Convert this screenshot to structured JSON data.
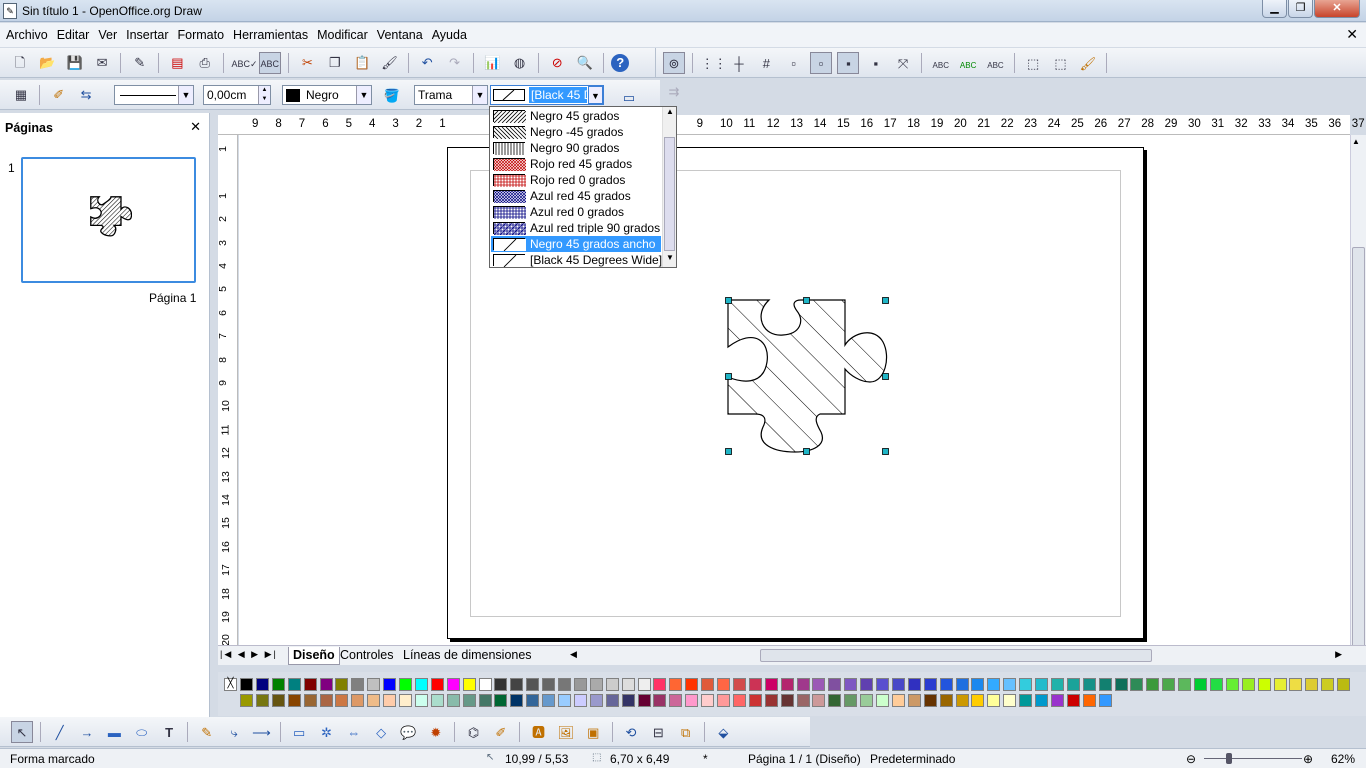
{
  "window": {
    "title": "Sin título 1 - OpenOffice.org Draw",
    "min_label": "▁",
    "max_label": "❐",
    "close_label": "✕"
  },
  "menu": [
    "Archivo",
    "Editar",
    "Ver",
    "Insertar",
    "Formato",
    "Herramientas",
    "Modificar",
    "Ventana",
    "Ayuda"
  ],
  "doc_close": "✕",
  "line_toolbar": {
    "line_width": "0,00cm",
    "line_color": "Negro",
    "area_style": "Trama",
    "pattern": "[Black 45 D"
  },
  "pages_panel": {
    "title": "Páginas",
    "close": "✕",
    "number": "1",
    "label": "Página 1"
  },
  "ruler": {
    "h_labels": [
      "9",
      "8",
      "7",
      "6",
      "5",
      "4",
      "3",
      "2",
      "1",
      "",
      "",
      "",
      "",
      "",
      "",
      "",
      "",
      "",
      "",
      "9",
      "10",
      "11",
      "12",
      "13",
      "14",
      "15",
      "16",
      "17",
      "18",
      "19",
      "20",
      "21",
      "22",
      "23",
      "24",
      "25",
      "26",
      "27",
      "28",
      "29",
      "30",
      "31",
      "32",
      "33",
      "34",
      "35",
      "36",
      "37"
    ],
    "v_labels": [
      "1",
      "",
      "1",
      "2",
      "3",
      "4",
      "5",
      "6",
      "7",
      "8",
      "9",
      "10",
      "11",
      "12",
      "13",
      "14",
      "15",
      "16",
      "17",
      "18",
      "19",
      "20"
    ]
  },
  "dropdown_items": [
    {
      "label": "Negro 45 grados",
      "pattern": "hatch45",
      "color": "#000000"
    },
    {
      "label": "Negro -45 grados",
      "pattern": "hatch-45",
      "color": "#000000"
    },
    {
      "label": "Negro 90 grados",
      "pattern": "hatch90",
      "color": "#000000"
    },
    {
      "label": "Rojo red 45 grados",
      "pattern": "cross45",
      "color": "#c00000"
    },
    {
      "label": "Rojo red 0 grados",
      "pattern": "cross0",
      "color": "#c00000"
    },
    {
      "label": "Azul red 45 grados",
      "pattern": "cross45",
      "color": "#000080"
    },
    {
      "label": "Azul red 0 grados",
      "pattern": "cross0",
      "color": "#000080"
    },
    {
      "label": "Azul red triple 90 grados",
      "pattern": "triple",
      "color": "#000080"
    },
    {
      "label": "Negro 45 grados ancho",
      "pattern": "wide45",
      "color": "#000000",
      "selected": true
    },
    {
      "label": "[Black 45 Degrees Wide]",
      "pattern": "wide45",
      "color": "#000000"
    }
  ],
  "tabs": [
    "Diseño",
    "Controles",
    "Líneas de dimensiones"
  ],
  "palette": [
    "#000000",
    "#000080",
    "#008000",
    "#008080",
    "#800000",
    "#800080",
    "#808000",
    "#808080",
    "#c0c0c0",
    "#0000ff",
    "#00ff00",
    "#00ffff",
    "#ff0000",
    "#ff00ff",
    "#ffff00",
    "#ffffff",
    "#333333",
    "#444444",
    "#555555",
    "#666666",
    "#777777",
    "#999999",
    "#aaaaaa",
    "#cccccc",
    "#dddddd",
    "#eeeeee",
    "#ff3366",
    "#ff6633",
    "#ff3300",
    "#e05a3a",
    "#ff6644",
    "#d24b4b",
    "#cc3355",
    "#cc0066",
    "#b4256e",
    "#a0388c",
    "#9b59b6",
    "#8050a0",
    "#7e57c2",
    "#6040b0",
    "#5a4fcf",
    "#4848c8",
    "#3030c0",
    "#2a3cd0",
    "#2255dd",
    "#1e6fe0",
    "#1a88ee",
    "#33aaff",
    "#66c0ff",
    "#33ccdd",
    "#22bbcc",
    "#20b2aa",
    "#1aa39a",
    "#169188",
    "#128070",
    "#0e6f5a",
    "#2e8b57",
    "#3c9a3c",
    "#4ca84c",
    "#5cb85c",
    "#00cc33",
    "#22dd44",
    "#66ee33",
    "#99ee22",
    "#ccff00",
    "#e6ee33",
    "#eedd44",
    "#ddcc33",
    "#cccc22",
    "#bbbb11",
    "#999900",
    "#777711",
    "#665511",
    "#884400",
    "#996633",
    "#aa6644",
    "#cc7744",
    "#dd9966",
    "#eebb88",
    "#ffccaa",
    "#ffeecc",
    "#ccffee",
    "#aaddcc",
    "#88bbaa",
    "#669988",
    "#447766",
    "#006633",
    "#003366",
    "#336699",
    "#6699cc",
    "#99ccff",
    "#ccccff",
    "#9999cc",
    "#666699",
    "#333366",
    "#660033",
    "#993366",
    "#cc6699",
    "#ff99cc",
    "#ffcccc",
    "#ff9999",
    "#ff6666",
    "#cc3333",
    "#993333",
    "#663333",
    "#996666",
    "#cc9999",
    "#336633",
    "#669966",
    "#99cc99",
    "#ccffcc",
    "#ffcc99",
    "#cc9966",
    "#663300",
    "#996600",
    "#cc9900",
    "#ffcc00",
    "#ffff99",
    "#ffffcc",
    "#009999",
    "#0099cc",
    "#9933cc",
    "#cc0000",
    "#ff6600",
    "#3399ff"
  ],
  "status": {
    "mode": "Forma marcado",
    "position": "10,99 / 5,53",
    "size": "6,70 x 6,49",
    "asterisk": "*",
    "page": "Página 1 / 1 (Diseño)",
    "style": "Predeterminado",
    "zoom": "62%"
  }
}
